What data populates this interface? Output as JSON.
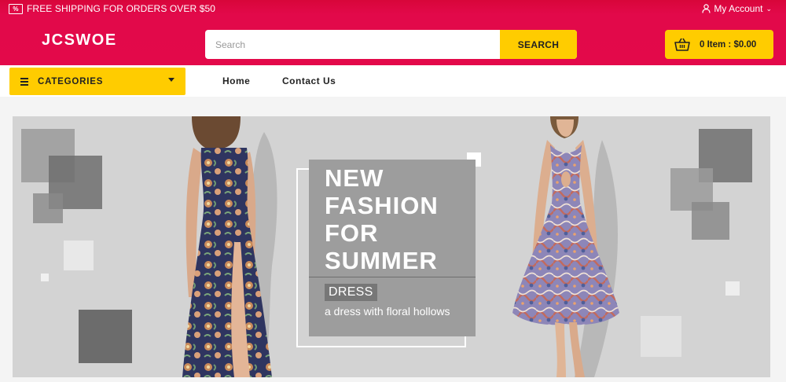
{
  "topbar": {
    "promo_icon": "%",
    "promo_text": "FREE SHIPPING FOR ORDERS OVER $50",
    "account_label": "My Account"
  },
  "header": {
    "logo": "JCSWOE",
    "search_placeholder": "Search",
    "search_value": "",
    "search_button": "SEARCH",
    "cart_label": "0 Item : $0.00"
  },
  "nav": {
    "categories_label": "CATEGORIES",
    "links": [
      "Home",
      "Contact Us"
    ]
  },
  "banner": {
    "headline": "NEW FASHION FOR SUMMER",
    "tag": "DRESS",
    "subtitle": "a dress with floral hollows"
  },
  "colors": {
    "brand": "#e3094a",
    "accent": "#ffcc00",
    "banner_bg": "#d3d3d3",
    "text_box": "#9d9d9d"
  },
  "icons": [
    "discount-tag-icon",
    "user-icon",
    "chevron-down-icon",
    "basket-icon",
    "menu-icon",
    "caret-down-icon"
  ]
}
